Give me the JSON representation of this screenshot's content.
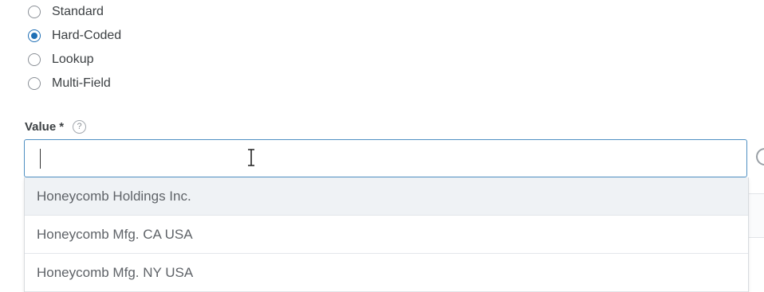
{
  "source_type": {
    "options": [
      {
        "label": "Standard",
        "checked": false
      },
      {
        "label": "Hard-Coded",
        "checked": true
      },
      {
        "label": "Lookup",
        "checked": false
      },
      {
        "label": "Multi-Field",
        "checked": false
      }
    ]
  },
  "value_field": {
    "label": "Value",
    "required_marker": "*",
    "help_icon": "?",
    "input_value": ""
  },
  "dropdown": {
    "options": [
      {
        "label": "Honeycomb Holdings Inc.",
        "highlighted": true
      },
      {
        "label": "Honeycomb Mfg. CA USA",
        "highlighted": false
      },
      {
        "label": "Honeycomb Mfg. NY USA",
        "highlighted": false
      }
    ]
  },
  "icons": {
    "radio": "radio-button",
    "help": "question-circle-icon",
    "refresh": "refresh-icon",
    "cursor": "text-cursor-icon"
  },
  "colors": {
    "accent": "#1f6fb5",
    "input_border": "#4f8fc2",
    "highlight_row": "#eff2f5"
  }
}
